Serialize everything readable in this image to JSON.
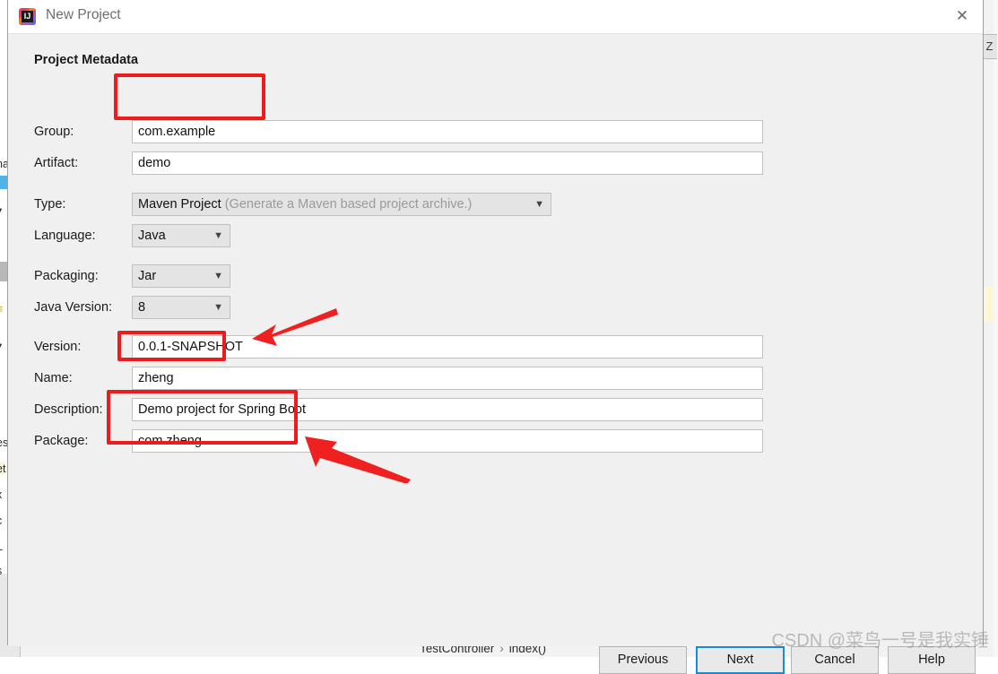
{
  "window": {
    "title": "New Project",
    "logo_icon": "intellij-idea-logo",
    "close_icon": "close-icon"
  },
  "dialog": {
    "section_title": "Project Metadata",
    "fields": [
      {
        "label": "Group:",
        "value": "com.example",
        "kind": "text",
        "name": "group"
      },
      {
        "label": "Artifact:",
        "value": "demo",
        "kind": "text",
        "name": "artifact"
      },
      {
        "label": "Type:",
        "value": "Maven Project",
        "hint": "(Generate a Maven based project archive.)",
        "kind": "select-wide",
        "name": "type"
      },
      {
        "label": "Language:",
        "value": "Java",
        "kind": "select-narrow",
        "name": "language"
      },
      {
        "label": "Packaging:",
        "value": "Jar",
        "kind": "select-narrow",
        "name": "packaging"
      },
      {
        "label": "Java Version:",
        "value": "8",
        "kind": "select-narrow",
        "name": "java-version"
      },
      {
        "label": "Version:",
        "value": "0.0.1-SNAPSHOT",
        "kind": "text",
        "name": "version"
      },
      {
        "label": "Name:",
        "value": "zheng",
        "kind": "text",
        "name": "name"
      },
      {
        "label": "Description:",
        "value": "Demo project for Spring Boot",
        "kind": "text",
        "name": "description"
      },
      {
        "label": "Package:",
        "value": "com.zheng",
        "kind": "text",
        "name": "package"
      }
    ],
    "buttons": [
      {
        "label": "Previous",
        "name": "previous",
        "default": false
      },
      {
        "label": "Next",
        "name": "next",
        "default": true
      },
      {
        "label": "Cancel",
        "name": "cancel",
        "default": false
      },
      {
        "label": "Help",
        "name": "help",
        "default": false
      }
    ],
    "chevron_glyph": "⌄"
  },
  "annotations": {
    "accent_color": "#ec1c1c",
    "focus_color": "#1a8ad4",
    "highlight_count": 3,
    "arrow_count": 2
  },
  "background": {
    "breadcrumb_class": "TestController",
    "breadcrumb_separator": "›",
    "breadcrumb_method": "index()",
    "right_tab_label": "Z",
    "left_fragments": [
      "na",
      "▾",
      "≡",
      "▾",
      "es",
      "et",
      "x",
      "c",
      "L",
      "s"
    ]
  },
  "watermark": {
    "text": "CSDN @菜鸟一号是我实锤"
  }
}
